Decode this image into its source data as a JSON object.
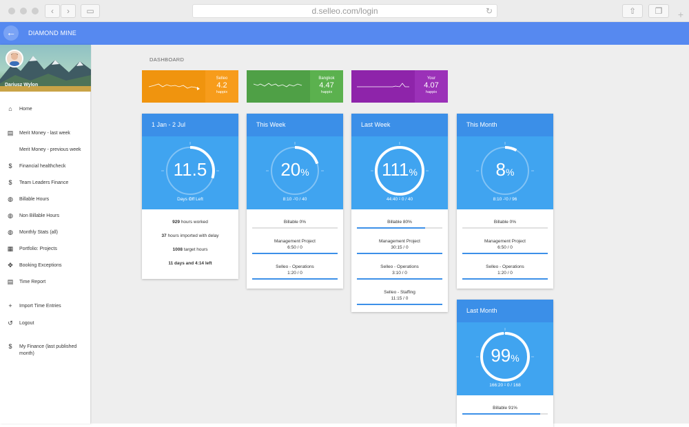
{
  "browser": {
    "url": "d.selleo.com/login"
  },
  "appbar": {
    "title": "DIAMOND MINE"
  },
  "sidebar": {
    "user_name": "Dariusz Wylon",
    "items": [
      {
        "label": "Home",
        "icon": "home-icon"
      },
      {
        "label": "Merit Money - last week",
        "icon": "merit-icon"
      },
      {
        "label": "Merit Money - previous week",
        "icon": ""
      },
      {
        "label": "Financial healthcheck",
        "icon": "dollar-icon"
      },
      {
        "label": "Team Leaders Finance",
        "icon": "dollar-icon"
      },
      {
        "label": "Billable Hours",
        "icon": "watch-icon"
      },
      {
        "label": "Non Billable Hours",
        "icon": "watch-icon"
      },
      {
        "label": "Monthly Stats (all)",
        "icon": "watch-icon"
      },
      {
        "label": "Portfolio: Projects",
        "icon": "calendar-icon"
      },
      {
        "label": "Booking Exceptions",
        "icon": "move-icon"
      },
      {
        "label": "Time Report",
        "icon": "report-icon"
      },
      {
        "label": "Import Time Entries",
        "icon": "plus-icon"
      },
      {
        "label": "Logout",
        "icon": "history-icon"
      },
      {
        "label": "My Finance (last published month)",
        "icon": "dollar-icon"
      }
    ]
  },
  "main": {
    "section_title": "DASHBOARD",
    "minis": [
      {
        "name": "Selleo",
        "value": "4.2",
        "unit": "happix",
        "color_spark": "#f0940e",
        "color_val": "#f79c1b"
      },
      {
        "name": "Bangkok",
        "value": "4.47",
        "unit": "happix",
        "color_spark": "#4fa046",
        "color_val": "#5bb14e"
      },
      {
        "name": "Your",
        "value": "4.07",
        "unit": "happix",
        "color_spark": "#8e24aa",
        "color_val": "#9b31b8"
      }
    ],
    "cards": [
      {
        "title": "1 Jan - 2 Jul",
        "ring_value": "11.5",
        "ring_unit": "",
        "ring_caption": "Days Off Left",
        "ring_fraction": 0.3,
        "stats": [
          {
            "bold": "929",
            "text": " hours worked"
          },
          {
            "bold": "37",
            "text": " hours imported with delay"
          },
          {
            "bold": "1008",
            "text": " target hours"
          },
          {
            "bold": "11 days and 4:14 left",
            "text": ""
          }
        ]
      },
      {
        "title": "This Week",
        "ring_value": "20",
        "ring_unit": "%",
        "ring_caption": "8:10 - 0 / 40",
        "ring_fraction": 0.2,
        "projects": [
          {
            "name": "Billable 0%",
            "value": "",
            "fill": 0
          },
          {
            "name": "Management Project",
            "value": "6:50 / 0",
            "fill": 1
          },
          {
            "name": "Selleo - Operations",
            "value": "1:20 / 0",
            "fill": 1
          }
        ]
      },
      {
        "title": "Last Week",
        "ring_value": "111",
        "ring_unit": "%",
        "ring_caption": "44:40 - 0 / 40",
        "ring_fraction": 1,
        "projects": [
          {
            "name": "Billable 80%",
            "value": "",
            "fill": 0.8
          },
          {
            "name": "Management Project",
            "value": "30:15 / 0",
            "fill": 1
          },
          {
            "name": "Selleo - Operations",
            "value": "3:10 / 0",
            "fill": 1
          },
          {
            "name": "Selleo - Staffing",
            "value": "11:15 / 0",
            "fill": 1
          }
        ]
      },
      {
        "title": "This Month",
        "ring_value": "8",
        "ring_unit": "%",
        "ring_caption": "8:10 - 0 / 96",
        "ring_fraction": 0.08,
        "projects": [
          {
            "name": "Billable 0%",
            "value": "",
            "fill": 0
          },
          {
            "name": "Management Project",
            "value": "6:50 / 0",
            "fill": 1
          },
          {
            "name": "Selleo - Operations",
            "value": "1:20 / 0",
            "fill": 1
          }
        ]
      },
      {
        "title": "Last Month",
        "ring_value": "99",
        "ring_unit": "%",
        "ring_caption": "166:20 - 0 / 168",
        "ring_fraction": 0.99,
        "projects": [
          {
            "name": "Billable 91%",
            "value": "",
            "fill": 0.91
          }
        ]
      }
    ]
  }
}
